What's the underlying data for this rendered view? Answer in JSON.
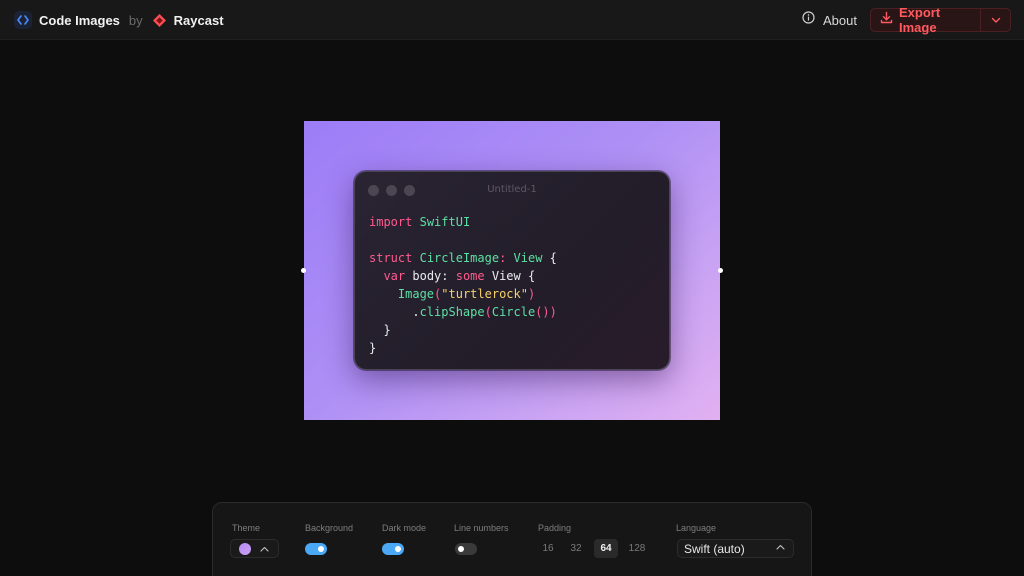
{
  "header": {
    "app_title": "Code Images",
    "by_text": "by",
    "company": "Raycast",
    "about_label": "About",
    "export_label": "Export Image",
    "export_color": "#ff5a5f"
  },
  "editor": {
    "window_title": "Untitled-1",
    "background_gradient": [
      "#9d7df7",
      "#e1b0f1"
    ],
    "code_lines": [
      [
        {
          "t": "import",
          "c": "keyword"
        },
        {
          "t": " ",
          "c": "plain"
        },
        {
          "t": "SwiftUI",
          "c": "type"
        }
      ],
      [],
      [
        {
          "t": "struct",
          "c": "keyword"
        },
        {
          "t": " ",
          "c": "plain"
        },
        {
          "t": "CircleImage",
          "c": "type"
        },
        {
          "t": ": ",
          "c": "keyword"
        },
        {
          "t": "View",
          "c": "type"
        },
        {
          "t": " {",
          "c": "plain"
        }
      ],
      [
        {
          "t": "  ",
          "c": "plain"
        },
        {
          "t": "var",
          "c": "keyword"
        },
        {
          "t": " body: ",
          "c": "plain"
        },
        {
          "t": "some",
          "c": "keyword"
        },
        {
          "t": " View {",
          "c": "plain"
        }
      ],
      [
        {
          "t": "    ",
          "c": "plain"
        },
        {
          "t": "Image",
          "c": "type"
        },
        {
          "t": "(",
          "c": "keyword"
        },
        {
          "t": "\"turtlerock\"",
          "c": "string"
        },
        {
          "t": ")",
          "c": "keyword"
        }
      ],
      [
        {
          "t": "      .",
          "c": "plain"
        },
        {
          "t": "clipShape",
          "c": "type"
        },
        {
          "t": "(",
          "c": "keyword"
        },
        {
          "t": "Circle",
          "c": "type"
        },
        {
          "t": "())",
          "c": "keyword"
        }
      ],
      [
        {
          "t": "  }",
          "c": "plain"
        }
      ],
      [
        {
          "t": "}",
          "c": "plain"
        }
      ]
    ]
  },
  "controls": {
    "theme": {
      "label": "Theme",
      "swatch_color": "#b58cf4"
    },
    "background": {
      "label": "Background",
      "on": true
    },
    "dark_mode": {
      "label": "Dark mode",
      "on": true
    },
    "line_numbers": {
      "label": "Line numbers",
      "on": false
    },
    "padding": {
      "label": "Padding",
      "options": [
        "16",
        "32",
        "64",
        "128"
      ],
      "selected": "64"
    },
    "language": {
      "label": "Language",
      "value": "Swift (auto)"
    }
  }
}
